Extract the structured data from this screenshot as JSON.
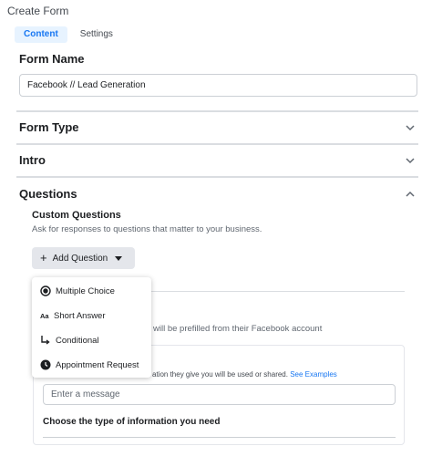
{
  "page_title": "Create Form",
  "tabs": [
    {
      "label": "Content",
      "active": true
    },
    {
      "label": "Settings",
      "active": false
    }
  ],
  "form_name": {
    "label": "Form Name",
    "value": "Facebook // Lead Generation"
  },
  "sections": {
    "form_type": "Form Type",
    "intro": "Intro",
    "questions": "Questions"
  },
  "custom_questions": {
    "title": "Custom Questions",
    "description": "Ask for responses to questions that matter to your business."
  },
  "add_question_label": "Add Question",
  "question_menu": [
    {
      "label": "Multiple Choice",
      "icon": "radio-selected-icon"
    },
    {
      "label": "Short Answer",
      "icon": "text-aa-icon"
    },
    {
      "label": "Conditional",
      "icon": "branch-arrow-icon"
    },
    {
      "label": "Appointment Request",
      "icon": "clock-icon"
    }
  ],
  "prefill_text": "will be prefilled from their Facebook account",
  "privacy_text": "ation they give you will be used or shared.",
  "privacy_link": "See Examples",
  "message_placeholder": "Enter a message",
  "info_type_label": "Choose the type of information you need",
  "colors": {
    "accent": "#1877f2",
    "tab_active_bg": "#e7f3ff",
    "button_bg": "#e4e6eb"
  }
}
